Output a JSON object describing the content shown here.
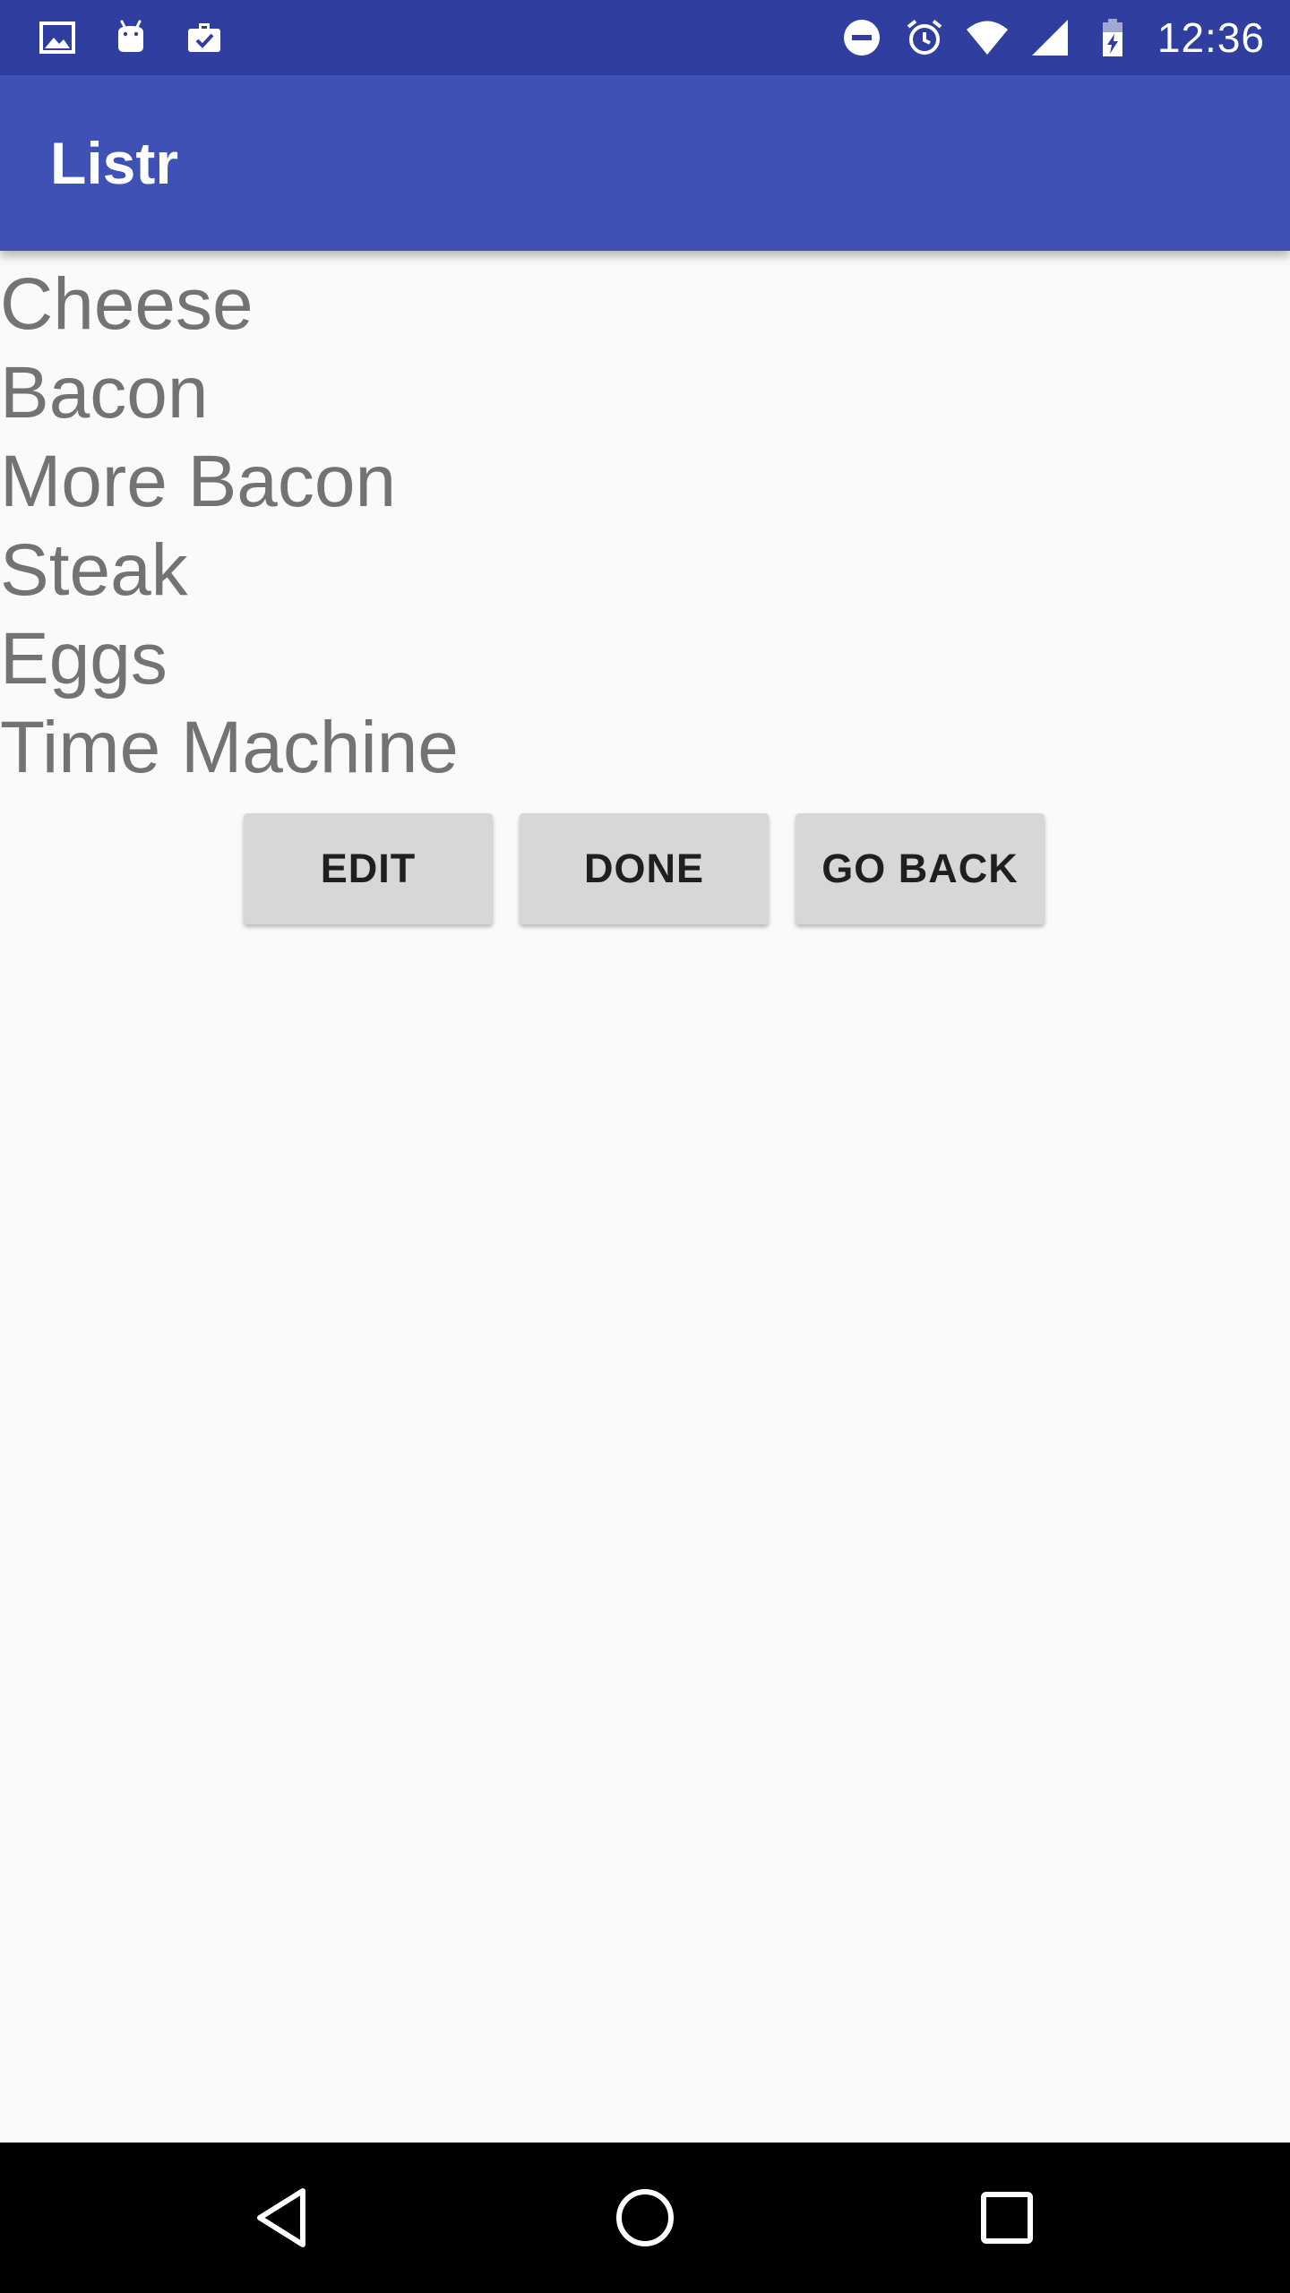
{
  "status_bar": {
    "time": "12:36",
    "left_icons": [
      "image-icon",
      "android-icon",
      "briefcase-check-icon"
    ],
    "right_icons": [
      "do-not-disturb-icon",
      "alarm-icon",
      "wifi-icon",
      "signal-icon",
      "battery-charging-icon"
    ],
    "background": "#303f9f"
  },
  "app_bar": {
    "title": "Listr",
    "background": "#3f51b5"
  },
  "list": {
    "items": [
      "Cheese",
      "Bacon",
      "More Bacon",
      "Steak",
      "Eggs",
      "Time Machine"
    ]
  },
  "buttons": {
    "edit_label": "EDIT",
    "done_label": "DONE",
    "go_back_label": "GO BACK"
  },
  "nav_bar": {
    "icons": [
      "back-icon",
      "home-icon",
      "recents-icon"
    ]
  }
}
